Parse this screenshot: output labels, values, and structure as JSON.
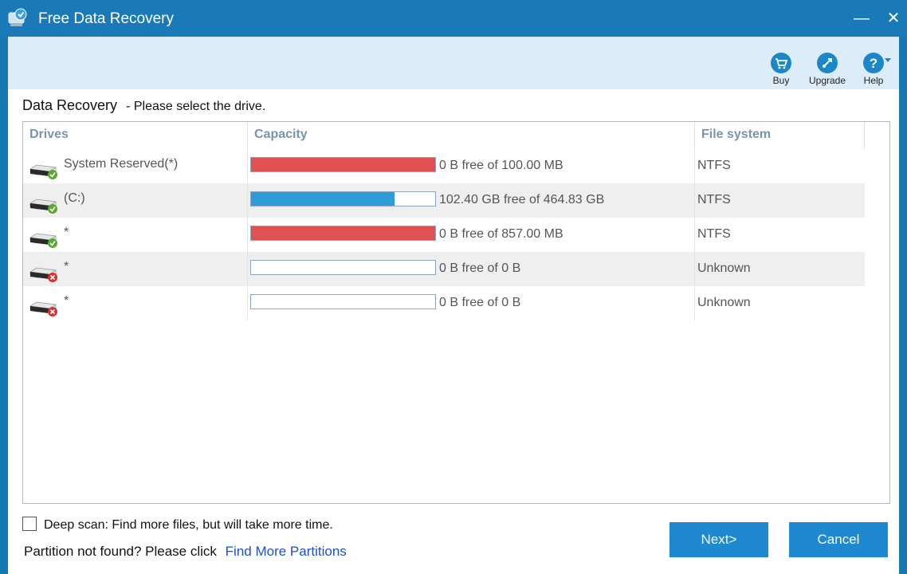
{
  "window": {
    "title": "Free Data Recovery",
    "minimize_glyph": "—",
    "close_glyph": "✕"
  },
  "toolbar": {
    "buy_label": "Buy",
    "upgrade_label": "Upgrade",
    "help_label": "Help"
  },
  "main": {
    "heading": "Data Recovery",
    "subheading": "- Please select the drive."
  },
  "table": {
    "columns": [
      "Drives",
      "Capacity",
      "File system"
    ],
    "rows": [
      {
        "name": "System Reserved(*)",
        "capacity": "0 B free of 100.00 MB",
        "filesystem": "NTFS",
        "used_fraction": 1.0,
        "status": "ok",
        "bar_color": "#e05252"
      },
      {
        "name": "(C:)",
        "capacity": "102.40 GB free of 464.83 GB",
        "filesystem": "NTFS",
        "used_fraction": 0.78,
        "status": "ok",
        "bar_color": "#2f9ad8"
      },
      {
        "name": "*",
        "capacity": "0 B free of 857.00 MB",
        "filesystem": "NTFS",
        "used_fraction": 1.0,
        "status": "ok",
        "bar_color": "#e05252"
      },
      {
        "name": "*",
        "capacity": "0 B free of 0 B",
        "filesystem": "Unknown",
        "used_fraction": 0,
        "status": "error",
        "bar_color": "#2f9ad8"
      },
      {
        "name": "*",
        "capacity": "0 B free of 0 B",
        "filesystem": "Unknown",
        "used_fraction": 0,
        "status": "error",
        "bar_color": "#2f9ad8"
      }
    ]
  },
  "options": {
    "deep_scan_label": "Deep scan: Find more files, but will take more time.",
    "deep_scan_checked": false
  },
  "partition": {
    "text": "Partition not found? Please click",
    "link": "Find More Partitions"
  },
  "buttons": {
    "next_label": "Next>",
    "cancel_label": "Cancel"
  },
  "colors": {
    "accent": "#1a7ab8",
    "toolbar_bg": "#dcecf8",
    "status_ok": "#5aa830",
    "status_error": "#d93030"
  }
}
